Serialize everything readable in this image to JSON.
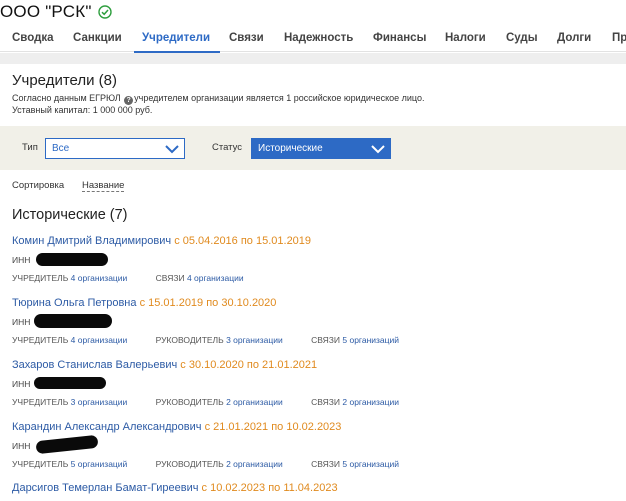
{
  "company": {
    "name": "ООО \"РСК\""
  },
  "tabs": [
    {
      "label": "Сводка",
      "active": false
    },
    {
      "label": "Санкции",
      "active": false
    },
    {
      "label": "Учредители",
      "active": true
    },
    {
      "label": "Связи",
      "active": false
    },
    {
      "label": "Надежность",
      "active": false
    },
    {
      "label": "Финансы",
      "active": false
    },
    {
      "label": "Налоги",
      "active": false
    },
    {
      "label": "Суды",
      "active": false
    },
    {
      "label": "Долги",
      "active": false
    },
    {
      "label": "Пре",
      "active": false
    }
  ],
  "section": {
    "title": "Учредители (8)",
    "info_prefix": "Согласно данным ЕГРЮЛ ",
    "info_suffix": "учредителем организации является 1 российское юридическое лицо.",
    "capital": "Уставный капитал: 1 000 000 руб."
  },
  "filters": {
    "type_label": "Тип",
    "type_value": "Все",
    "status_label": "Статус",
    "status_value": "Исторические"
  },
  "sort": {
    "label": "Сортировка",
    "value": "Название"
  },
  "group_title": "Исторические (7)",
  "inn_label": "ИНН",
  "persons": [
    {
      "name": "Комин Дмитрий Владимирович",
      "period": "с 05.04.2016 по 15.01.2019",
      "roles": [
        {
          "role": "УЧРЕДИТЕЛЬ",
          "link": "4 организации"
        },
        {
          "role": "СВЯЗИ",
          "link": "4 организации"
        }
      ]
    },
    {
      "name": "Тюрина Ольга Петровна",
      "period": "с 15.01.2019 по 30.10.2020",
      "roles": [
        {
          "role": "УЧРЕДИТЕЛЬ",
          "link": "4 организации"
        },
        {
          "role": "РУКОВОДИТЕЛЬ",
          "link": "3 организации"
        },
        {
          "role": "СВЯЗИ",
          "link": "5 организаций"
        }
      ]
    },
    {
      "name": "Захаров Станислав Валерьевич",
      "period": "с 30.10.2020 по 21.01.2021",
      "roles": [
        {
          "role": "УЧРЕДИТЕЛЬ",
          "link": "3 организации"
        },
        {
          "role": "РУКОВОДИТЕЛЬ",
          "link": "2 организации"
        },
        {
          "role": "СВЯЗИ",
          "link": "2 организации"
        }
      ]
    },
    {
      "name": "Карандин Александр Александрович",
      "period": "с 21.01.2021 по 10.02.2023",
      "roles": [
        {
          "role": "УЧРЕДИТЕЛЬ",
          "link": "5 организаций"
        },
        {
          "role": "РУКОВОДИТЕЛЬ",
          "link": "2 организации"
        },
        {
          "role": "СВЯЗИ",
          "link": "5 организаций"
        }
      ]
    },
    {
      "name": "Дарсигов Темерлан Бамат-Гиреевич",
      "period": "с 10.02.2023 по 11.04.2023",
      "roles": []
    }
  ],
  "colors": {
    "accent": "#2d6ac5",
    "link": "#2d5ba5",
    "period": "#e08a1e",
    "verified": "#2e9e3e"
  }
}
